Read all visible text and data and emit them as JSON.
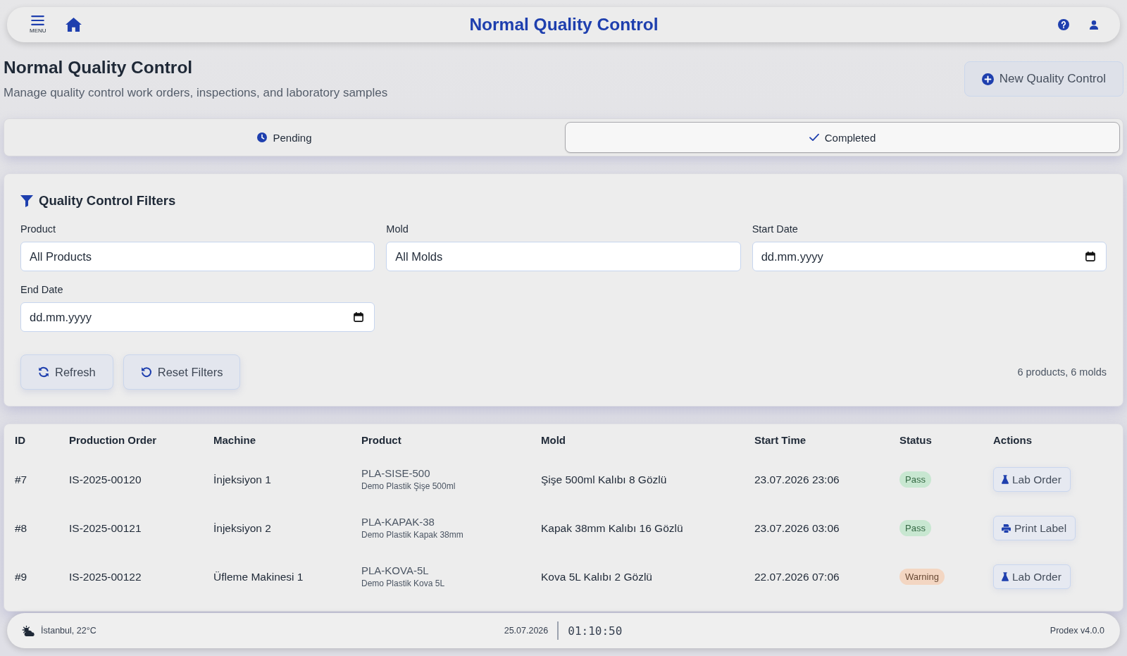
{
  "top_bar": {
    "menu_label": "MENU",
    "title": "Normal Quality Control"
  },
  "page_header": {
    "title": "Normal Quality Control",
    "subtitle": "Manage quality control work orders, inspections, and laboratory samples",
    "primary_button": "New Quality Control"
  },
  "tabs": [
    {
      "label": "Pending",
      "kind": "pending",
      "selected": false
    },
    {
      "label": "Completed",
      "kind": "completed",
      "selected": true
    }
  ],
  "filters": {
    "title": "Quality Control Filters",
    "fields": [
      {
        "label": "Product",
        "kind": "select",
        "value": "All Products"
      },
      {
        "label": "Mold",
        "kind": "select",
        "value": "All Molds"
      },
      {
        "label": "Start Date",
        "kind": "date",
        "placeholder": "dd.mm.yyyy"
      },
      {
        "label": "End Date",
        "kind": "date",
        "placeholder": "dd.mm.yyyy"
      }
    ],
    "buttons": [
      {
        "label": "Refresh",
        "kind": "refresh"
      },
      {
        "label": "Reset Filters",
        "kind": "reset"
      }
    ],
    "summary": "6 products, 6 molds"
  },
  "table": {
    "columns": [
      "ID",
      "Production Order",
      "Machine",
      "Product",
      "Mold",
      "Start Time",
      "Status",
      "Actions"
    ],
    "rows": [
      {
        "id": "#7",
        "production_order": "IS-2025-00120",
        "machine": "İnjeksiyon 1",
        "product_code": "PLA-SISE-500",
        "product_name": "Demo Plastik Şişe 500ml",
        "mold": "Şişe 500ml Kalıbı 8 Gözlü",
        "start_time": "23.07.2026 23:06",
        "status": {
          "label": "Pass",
          "color": "#c8e7d1"
        },
        "action": {
          "label": "Lab Order",
          "kind": "lab"
        }
      },
      {
        "id": "#8",
        "production_order": "IS-2025-00121",
        "machine": "İnjeksiyon 2",
        "product_code": "PLA-KAPAK-38",
        "product_name": "Demo Plastik Kapak 38mm",
        "mold": "Kapak 38mm Kalıbı 16 Gözlü",
        "start_time": "23.07.2026 03:06",
        "status": {
          "label": "Pass",
          "color": "#c8e7d1"
        },
        "action": {
          "label": "Print Label",
          "kind": "print"
        }
      },
      {
        "id": "#9",
        "production_order": "IS-2025-00122",
        "machine": "Üfleme Makinesi 1",
        "product_code": "PLA-KOVA-5L",
        "product_name": "Demo Plastik Kova 5L",
        "mold": "Kova 5L Kalıbı 2 Gözlü",
        "start_time": "22.07.2026 07:06",
        "status": {
          "label": "Warning",
          "color": "#f3d6c2"
        },
        "action": {
          "label": "Lab Order",
          "kind": "lab"
        }
      }
    ]
  },
  "status_bar": {
    "location": "İstanbul, 22°C",
    "date": "25.07.2026",
    "time": "01:10:50",
    "version": "Prodex v4.0.0"
  }
}
